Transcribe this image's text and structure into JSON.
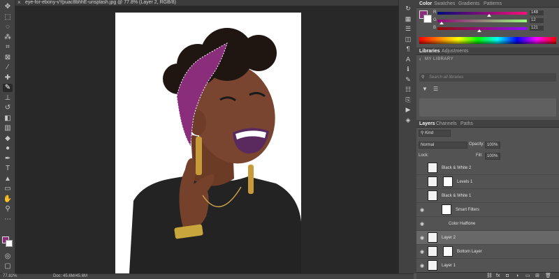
{
  "document": {
    "tab_title": "eye-for-ebony-vYpuac8bhhE-unsplash.jpg @ 77.8% (Layer 2, RGB/8)",
    "close_glyph": "×"
  },
  "toolbar": {
    "tools": [
      {
        "name": "move-icon",
        "glyph": "✥"
      },
      {
        "name": "artboard-icon",
        "glyph": "⬚"
      },
      {
        "name": "lasso-icon",
        "glyph": "◌"
      },
      {
        "name": "quick-select-icon",
        "glyph": "⁂"
      },
      {
        "name": "crop-icon",
        "glyph": "⌗"
      },
      {
        "name": "frame-icon",
        "glyph": "⊠"
      },
      {
        "name": "eyedropper-icon",
        "glyph": "⁄"
      },
      {
        "name": "healing-icon",
        "glyph": "✚"
      },
      {
        "name": "brush-icon",
        "glyph": "✎"
      },
      {
        "name": "stamp-icon",
        "glyph": "⊥"
      },
      {
        "name": "history-brush-icon",
        "glyph": "↺"
      },
      {
        "name": "eraser-icon",
        "glyph": "◧"
      },
      {
        "name": "gradient-icon",
        "glyph": "▥"
      },
      {
        "name": "blur-icon",
        "glyph": "◆"
      },
      {
        "name": "dodge-icon",
        "glyph": "●"
      },
      {
        "name": "pen-icon",
        "glyph": "✒"
      },
      {
        "name": "type-icon",
        "glyph": "T"
      },
      {
        "name": "path-select-icon",
        "glyph": "▲"
      },
      {
        "name": "rectangle-icon",
        "glyph": "▭"
      },
      {
        "name": "hand-icon",
        "glyph": "✋"
      },
      {
        "name": "zoom-icon",
        "glyph": "⚲"
      },
      {
        "name": "more-icon",
        "glyph": "⋯"
      }
    ],
    "bottom": [
      {
        "name": "quick-mask-icon",
        "glyph": "◎"
      },
      {
        "name": "screen-mode-icon",
        "glyph": "▢"
      }
    ]
  },
  "status_bar": {
    "zoom": "77.82%",
    "doc_info": "Doc: 45.6M/45.6M"
  },
  "mini_icons": [
    {
      "name": "history-icon",
      "glyph": "↻"
    },
    {
      "name": "swatches-icon",
      "glyph": "▦"
    },
    {
      "name": "adjust-icon",
      "glyph": "☰"
    },
    {
      "name": "channels-icon",
      "glyph": "◫"
    },
    {
      "name": "paragraph-icon",
      "glyph": "¶"
    },
    {
      "name": "character-icon",
      "glyph": "A"
    },
    {
      "name": "info-icon",
      "glyph": "ℹ"
    },
    {
      "name": "brush-settings-icon",
      "glyph": "✎"
    },
    {
      "name": "properties-icon",
      "glyph": "☷"
    },
    {
      "name": "clone-source-icon",
      "glyph": "⎘"
    },
    {
      "name": "actions-icon",
      "glyph": "▶"
    },
    {
      "name": "styles-icon",
      "glyph": "◈"
    }
  ],
  "color_panel": {
    "tabs": [
      "Color",
      "Swatches",
      "Gradients",
      "Patterns"
    ],
    "sliders": [
      {
        "label": "R",
        "value": "148",
        "fraction": 0.58
      },
      {
        "label": "G",
        "value": "12",
        "fraction": 0.05
      },
      {
        "label": "B",
        "value": "121",
        "fraction": 0.47
      }
    ],
    "fg_color": "#8a2d7a"
  },
  "libraries_panel": {
    "tabs": [
      "Libraries",
      "Adjustments"
    ],
    "library_name": "MY LIBRARY",
    "search_placeholder": "Search all libraries"
  },
  "layers_panel": {
    "tabs": [
      "Layers",
      "Channels",
      "Paths"
    ],
    "kind_label": "Kind",
    "blend_mode": "Normal",
    "opacity_label": "Opacity:",
    "opacity_value": "100%",
    "lock_label": "Lock:",
    "fill_label": "Fill:",
    "fill_value": "100%",
    "layers": [
      {
        "name": "Black & White 2",
        "visible": false,
        "selected": false
      },
      {
        "name": "Levels 1",
        "visible": false,
        "selected": false
      },
      {
        "name": "Black & White 1",
        "visible": false,
        "selected": false
      },
      {
        "name": "Smart Filters",
        "visible": true,
        "selected": false
      },
      {
        "name": "Color Halftone",
        "visible": true,
        "selected": false
      },
      {
        "name": "Layer 2",
        "visible": true,
        "selected": true
      },
      {
        "name": "Bottom Layer",
        "visible": true,
        "selected": false
      },
      {
        "name": "Layer 1",
        "visible": true,
        "selected": false
      }
    ],
    "footer_icons": [
      "link-icon",
      "fx-icon",
      "mask-icon",
      "adjustment-icon",
      "group-icon",
      "new-layer-icon",
      "trash-icon"
    ]
  }
}
